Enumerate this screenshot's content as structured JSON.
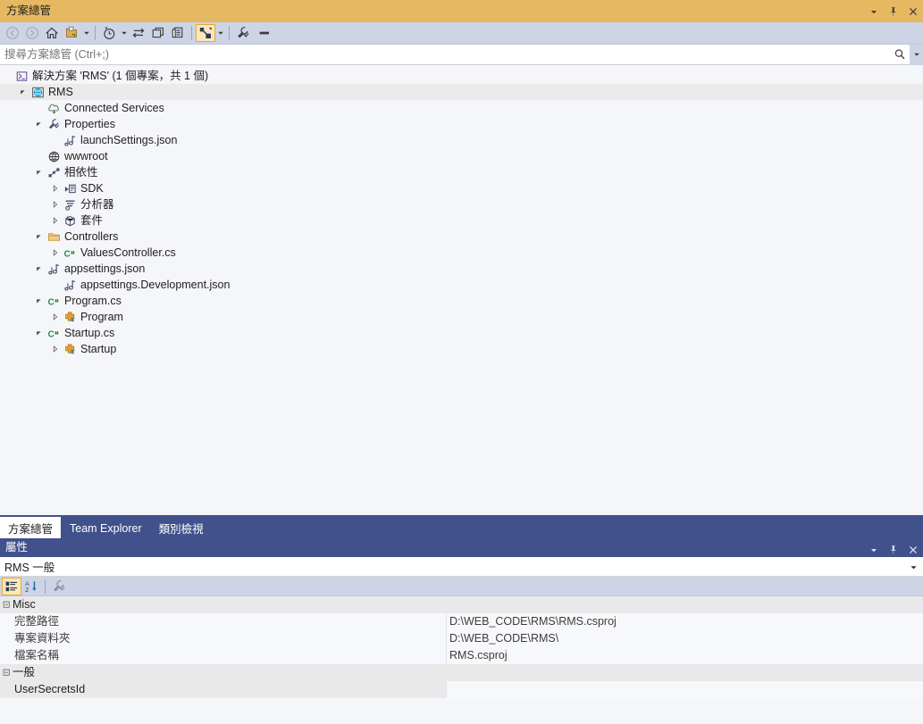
{
  "solution_explorer": {
    "title": "方案總管",
    "window_buttons": [
      {
        "name": "dropdown",
        "icon": "chevron-down-icon"
      },
      {
        "name": "pin",
        "icon": "pin-icon"
      },
      {
        "name": "close",
        "icon": "close-icon"
      }
    ],
    "toolbar": [
      {
        "name": "back",
        "icon": "back-arrow-icon",
        "enabled": false,
        "tooltip": "上一頁"
      },
      {
        "name": "forward",
        "icon": "forward-arrow-icon",
        "enabled": false,
        "tooltip": "下一頁"
      },
      {
        "name": "home",
        "icon": "home-icon",
        "enabled": true,
        "tooltip": "首頁"
      },
      {
        "name": "pending-changes",
        "icon": "pending-changes-icon",
        "enabled": true,
        "tooltip": "切換擱置的變更篩選"
      },
      {
        "name": "pending-changes-caret",
        "icon": "caret-down-icon",
        "enabled": true
      },
      {
        "name": "separator1",
        "icon": "separator"
      },
      {
        "name": "sync-history",
        "icon": "clock-icon",
        "enabled": true,
        "tooltip": "最近使用"
      },
      {
        "name": "sync-history-caret",
        "icon": "caret-down-icon",
        "enabled": true
      },
      {
        "name": "sync-with-active-document",
        "icon": "sync-arrows-icon",
        "enabled": true,
        "tooltip": "與現用文件同步"
      },
      {
        "name": "refresh",
        "icon": "refresh-window-icon",
        "enabled": true,
        "tooltip": "重新整理"
      },
      {
        "name": "collapse-all",
        "icon": "collapse-all-icon",
        "enabled": true,
        "tooltip": "全部摺疊"
      },
      {
        "name": "separator2",
        "icon": "separator"
      },
      {
        "name": "show-all-files",
        "icon": "show-all-files-icon",
        "enabled": true,
        "active": true,
        "tooltip": "顯示所有檔案"
      },
      {
        "name": "show-all-files-caret",
        "icon": "caret-down-icon",
        "enabled": true
      },
      {
        "name": "separator3",
        "icon": "separator"
      },
      {
        "name": "properties",
        "icon": "wrench-icon",
        "enabled": true,
        "tooltip": "屬性"
      },
      {
        "name": "preview-selected-items",
        "icon": "preview-icon",
        "enabled": true,
        "tooltip": "預覽選取的項目"
      }
    ],
    "search": {
      "placeholder": "搜尋方案總管 (Ctrl+;)",
      "value": "",
      "search_icon": "magnifier-icon",
      "caret_icon": "caret-down-icon"
    },
    "tree": [
      {
        "label": "解決方案 'RMS' (1 個專案，共 1 個)",
        "indent": 0,
        "expander": "none",
        "icon": "solution-icon",
        "selected": false
      },
      {
        "label": "RMS",
        "indent": 1,
        "expander": "expanded",
        "icon": "web-project-icon",
        "selected": true
      },
      {
        "label": "Connected Services",
        "indent": 2,
        "expander": "none",
        "icon": "connected-services-icon",
        "selected": false
      },
      {
        "label": "Properties",
        "indent": 2,
        "expander": "expanded",
        "icon": "wrench-node-icon",
        "selected": false
      },
      {
        "label": "launchSettings.json",
        "indent": 3,
        "expander": "none",
        "icon": "json-icon",
        "selected": false
      },
      {
        "label": "wwwroot",
        "indent": 2,
        "expander": "none",
        "icon": "globe-icon",
        "selected": false
      },
      {
        "label": "相依性",
        "indent": 2,
        "expander": "expanded",
        "icon": "dependencies-icon",
        "selected": false
      },
      {
        "label": "SDK",
        "indent": 3,
        "expander": "collapsed",
        "icon": "sdk-icon",
        "selected": false
      },
      {
        "label": "分析器",
        "indent": 3,
        "expander": "collapsed",
        "icon": "analyzer-icon",
        "selected": false
      },
      {
        "label": "套件",
        "indent": 3,
        "expander": "collapsed",
        "icon": "package-icon",
        "selected": false
      },
      {
        "label": "Controllers",
        "indent": 2,
        "expander": "expanded",
        "icon": "folder-icon",
        "selected": false
      },
      {
        "label": "ValuesController.cs",
        "indent": 3,
        "expander": "collapsed",
        "icon": "csharp-icon",
        "selected": false
      },
      {
        "label": "appsettings.json",
        "indent": 2,
        "expander": "expanded",
        "icon": "json-icon",
        "selected": false
      },
      {
        "label": "appsettings.Development.json",
        "indent": 3,
        "expander": "none",
        "icon": "json-icon",
        "selected": false
      },
      {
        "label": "Program.cs",
        "indent": 2,
        "expander": "expanded",
        "icon": "csharp-icon",
        "selected": false
      },
      {
        "label": "Program",
        "indent": 3,
        "expander": "collapsed",
        "icon": "class-icon",
        "selected": false
      },
      {
        "label": "Startup.cs",
        "indent": 2,
        "expander": "expanded",
        "icon": "csharp-icon",
        "selected": false
      },
      {
        "label": "Startup",
        "indent": 3,
        "expander": "collapsed",
        "icon": "class-icon",
        "selected": false
      }
    ],
    "tabs": [
      {
        "label": "方案總管",
        "active": true
      },
      {
        "label": "Team Explorer",
        "active": false
      },
      {
        "label": "類別檢視",
        "active": false
      }
    ]
  },
  "properties_panel": {
    "title": "屬性",
    "window_buttons": [
      {
        "name": "dropdown",
        "icon": "chevron-down-icon"
      },
      {
        "name": "pin",
        "icon": "pin-icon"
      },
      {
        "name": "close",
        "icon": "close-icon"
      }
    ],
    "object_selector": {
      "value": "RMS 一般",
      "caret_icon": "caret-down-icon"
    },
    "toolbar": [
      {
        "name": "categorized",
        "icon": "categorized-icon",
        "active": true,
        "tooltip": "分類"
      },
      {
        "name": "alphabetical",
        "icon": "sort-az-icon",
        "active": false,
        "tooltip": "字母順序"
      },
      {
        "name": "separator",
        "icon": "separator"
      },
      {
        "name": "property-pages",
        "icon": "wrench-icon",
        "active": false,
        "tooltip": "屬性頁"
      }
    ],
    "grid": [
      {
        "type": "category",
        "label": "Misc",
        "collapsed": false
      },
      {
        "type": "item",
        "name": "完整路徑",
        "value": "D:\\WEB_CODE\\RMS\\RMS.csproj",
        "selected": false
      },
      {
        "type": "item",
        "name": "專案資料夾",
        "value": "D:\\WEB_CODE\\RMS\\",
        "selected": false
      },
      {
        "type": "item",
        "name": "檔案名稱",
        "value": "RMS.csproj",
        "selected": false
      },
      {
        "type": "category",
        "label": "一般",
        "collapsed": false
      },
      {
        "type": "item",
        "name": "UserSecretsId",
        "value": "",
        "selected": true
      }
    ]
  },
  "colors": {
    "title_accent": "#e6b861",
    "toolbar_bg": "#ccd4e6",
    "tab_strip_bg": "#41518c",
    "pane_bg": "#f5f6fa",
    "selection": "#ebebeb",
    "category_bg": "#e9e9e9",
    "active_button_border": "#e0a93c"
  }
}
